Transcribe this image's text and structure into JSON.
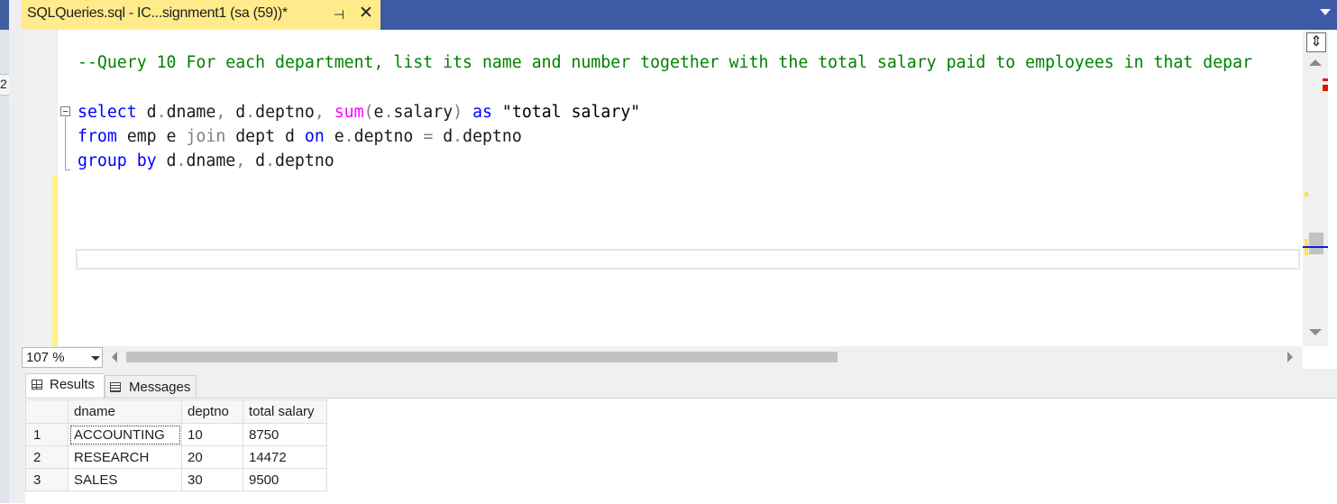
{
  "tab": {
    "title": "SQLQueries.sql - IC...signment1 (sa (59))*",
    "pin_icon": "pin-icon",
    "close_icon": "close-icon"
  },
  "left_strip": {
    "visible_number": "2"
  },
  "editor": {
    "lines": [
      {
        "segments": [
          {
            "text": "--Query 10 For each department, list its name and number together with the total salary paid to employees in that depar",
            "style": "cm"
          }
        ]
      },
      {
        "segments": []
      },
      {
        "segments": [
          {
            "text": "select",
            "style": "kw"
          },
          {
            "text": " d",
            "style": ""
          },
          {
            "text": ".",
            "style": "op"
          },
          {
            "text": "dname",
            "style": ""
          },
          {
            "text": ",",
            "style": "op"
          },
          {
            "text": " d",
            "style": ""
          },
          {
            "text": ".",
            "style": "op"
          },
          {
            "text": "deptno",
            "style": ""
          },
          {
            "text": ",",
            "style": "op"
          },
          {
            "text": " ",
            "style": ""
          },
          {
            "text": "sum",
            "style": "fn"
          },
          {
            "text": "(",
            "style": "op"
          },
          {
            "text": "e",
            "style": ""
          },
          {
            "text": ".",
            "style": "op"
          },
          {
            "text": "salary",
            "style": ""
          },
          {
            "text": ")",
            "style": "op"
          },
          {
            "text": " ",
            "style": ""
          },
          {
            "text": "as",
            "style": "kw"
          },
          {
            "text": " \"total salary\"",
            "style": "str"
          }
        ]
      },
      {
        "segments": [
          {
            "text": "from",
            "style": "kw"
          },
          {
            "text": " emp e ",
            "style": ""
          },
          {
            "text": "join",
            "style": "op"
          },
          {
            "text": " dept d ",
            "style": ""
          },
          {
            "text": "on",
            "style": "kw"
          },
          {
            "text": " e",
            "style": ""
          },
          {
            "text": ".",
            "style": "op"
          },
          {
            "text": "deptno ",
            "style": ""
          },
          {
            "text": "=",
            "style": "op"
          },
          {
            "text": " d",
            "style": ""
          },
          {
            "text": ".",
            "style": "op"
          },
          {
            "text": "deptno",
            "style": ""
          }
        ]
      },
      {
        "segments": [
          {
            "text": "group by",
            "style": "kw"
          },
          {
            "text": " d",
            "style": ""
          },
          {
            "text": ".",
            "style": "op"
          },
          {
            "text": "dname",
            "style": ""
          },
          {
            "text": ",",
            "style": "op"
          },
          {
            "text": " d",
            "style": ""
          },
          {
            "text": ".",
            "style": "op"
          },
          {
            "text": "deptno",
            "style": ""
          }
        ]
      }
    ]
  },
  "zoom": {
    "value": "107 %"
  },
  "results": {
    "tabs": [
      {
        "label": "Results",
        "icon": "grid-icon"
      },
      {
        "label": "Messages",
        "icon": "messages-icon"
      }
    ],
    "columns": [
      "",
      "dname",
      "deptno",
      "total salary"
    ],
    "rows": [
      [
        "1",
        "ACCOUNTING",
        "10",
        "8750"
      ],
      [
        "2",
        "RESEARCH",
        "20",
        "14472"
      ],
      [
        "3",
        "SALES",
        "30",
        "9500"
      ]
    ]
  },
  "colors": {
    "tab_active": "#ffeb8c",
    "tab_bar": "#3f5aa5",
    "keyword": "#0000ff",
    "function": "#ff00ff",
    "comment": "#008000"
  }
}
